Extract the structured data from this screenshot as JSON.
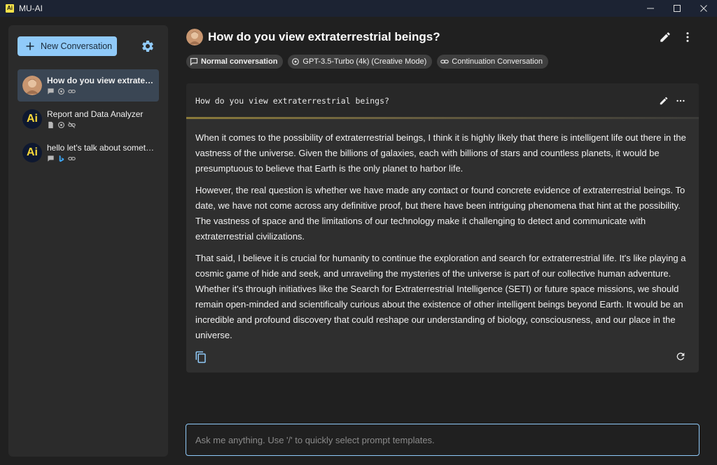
{
  "app": {
    "title": "MU-AI",
    "logo_text": "Ai"
  },
  "colors": {
    "accent": "#90caf9",
    "active_item": "#3a4654",
    "titlebar": "#1c2333",
    "background": "#202020",
    "sidebar": "#2b2b2b",
    "card": "#2f2f2f"
  },
  "sidebar": {
    "new_conversation_label": "New Conversation",
    "conversations": [
      {
        "title": "How do you view extraterrestrial beings?",
        "avatar": "user-photo",
        "icons": [
          "chat-icon",
          "openai-icon",
          "link-icon"
        ],
        "active": true
      },
      {
        "title": "Report and Data Analyzer",
        "avatar": "ai-logo",
        "avatar_text": "Ai",
        "icons": [
          "document-icon",
          "openai-icon",
          "link-off-icon"
        ],
        "active": false
      },
      {
        "title": "hello let's talk about something",
        "avatar": "ai-logo",
        "avatar_text": "Ai",
        "icons": [
          "chat-icon",
          "bing-icon",
          "link-icon"
        ],
        "active": false
      }
    ]
  },
  "header": {
    "title": "How do you view extraterrestrial beings?",
    "tags": [
      {
        "label": "Normal conversation",
        "icon": "chat-icon"
      },
      {
        "label": "GPT-3.5-Turbo (4k) (Creative Mode)",
        "icon": "openai-icon"
      },
      {
        "label": "Continuation Conversation",
        "icon": "link-icon"
      }
    ]
  },
  "message": {
    "question": "How do you view extraterrestrial beings?",
    "answer_paragraphs": [
      "When it comes to the possibility of extraterrestrial beings, I think it is highly likely that there is intelligent life out there in the vastness of the universe. Given the billions of galaxies, each with billions of stars and countless planets, it would be presumptuous to believe that Earth is the only planet to harbor life.",
      "However, the real question is whether we have made any contact or found concrete evidence of extraterrestrial beings. To date, we have not come across any definitive proof, but there have been intriguing phenomena that hint at the possibility. The vastness of space and the limitations of our technology make it challenging to detect and communicate with extraterrestrial civilizations.",
      "That said, I believe it is crucial for humanity to continue the exploration and search for extraterrestrial life. It's like playing a cosmic game of hide and seek, and unraveling the mysteries of the universe is part of our collective human adventure. Whether it's through initiatives like the Search for Extraterrestrial Intelligence (SETI) or future space missions, we should remain open-minded and scientifically curious about the existence of other intelligent beings beyond Earth. It would be an incredible and profound discovery that could reshape our understanding of biology, consciousness, and our place in the universe."
    ]
  },
  "input": {
    "placeholder": "Ask me anything. Use '/' to quickly select prompt templates.",
    "value": ""
  }
}
